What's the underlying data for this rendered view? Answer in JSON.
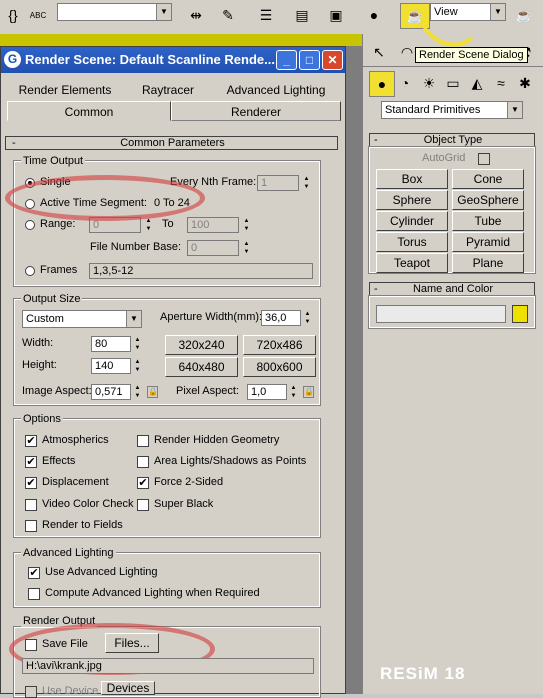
{
  "toolbar": {
    "abc_label": "ABC",
    "view_combo": "View",
    "tooltip": "Render Scene Dialog"
  },
  "dialog": {
    "title": "Render Scene: Default Scanline Rende...",
    "tabs_row1": [
      "Render Elements",
      "Raytracer",
      "Advanced Lighting"
    ],
    "tabs_row2": [
      "Common",
      "Renderer"
    ],
    "rollout_title": "Common Parameters",
    "time_output": {
      "title": "Time Output",
      "single": "Single",
      "every_nth": "Every Nth Frame:",
      "every_nth_value": "1",
      "active_segment": "Active Time Segment:",
      "active_segment_value": "0 To 24",
      "range": "Range:",
      "range_from": "0",
      "range_to_label": "To",
      "range_to": "100",
      "file_number_base": "File Number Base:",
      "file_number_base_value": "0",
      "frames": "Frames",
      "frames_value": "1,3,5-12"
    },
    "output_size": {
      "title": "Output Size",
      "preset": "Custom",
      "aperture_label": "Aperture Width(mm):",
      "aperture_value": "36,0",
      "width_label": "Width:",
      "width_value": "80",
      "height_label": "Height:",
      "height_value": "140",
      "presets": [
        "320x240",
        "720x486",
        "640x480",
        "800x600"
      ],
      "image_aspect_label": "Image Aspect:",
      "image_aspect_value": "0,571",
      "pixel_aspect_label": "Pixel Aspect:",
      "pixel_aspect_value": "1,0"
    },
    "options": {
      "title": "Options",
      "items": [
        {
          "label": "Atmospherics",
          "checked": true
        },
        {
          "label": "Render Hidden Geometry",
          "checked": false
        },
        {
          "label": "Effects",
          "checked": true
        },
        {
          "label": "Area Lights/Shadows as Points",
          "checked": false
        },
        {
          "label": "Displacement",
          "checked": true
        },
        {
          "label": "Force 2-Sided",
          "checked": true
        },
        {
          "label": "Video Color Check",
          "checked": false
        },
        {
          "label": "Super Black",
          "checked": false
        },
        {
          "label": "Render to Fields",
          "checked": false
        }
      ]
    },
    "advanced_lighting": {
      "title": "Advanced Lighting",
      "use": "Use Advanced Lighting",
      "compute": "Compute Advanced Lighting when Required"
    },
    "render_output": {
      "title": "Render Output",
      "save_file": "Save File",
      "files_button": "Files...",
      "path": "H:\\avi\\krank.jpg",
      "use_device": "Use Device",
      "devices_button": "Devices"
    }
  },
  "command_panel": {
    "category_combo": "Standard Primitives",
    "object_type_title": "Object Type",
    "autogrid": "AutoGrid",
    "buttons": [
      "Box",
      "Cone",
      "Sphere",
      "GeoSphere",
      "Cylinder",
      "Tube",
      "Torus",
      "Pyramid",
      "Teapot",
      "Plane"
    ],
    "name_color_title": "Name and Color",
    "color_swatch": "#f0e000"
  },
  "watermark": "RESiM 18",
  "colors": {
    "title_bar": "#2050b0",
    "highlight_ellipse": "#d23c3c",
    "viewport_yellow": "#c9c400"
  }
}
